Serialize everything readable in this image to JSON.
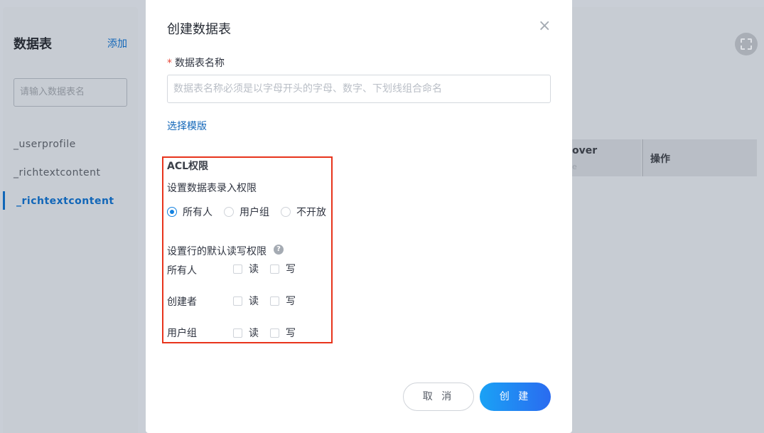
{
  "sidebar": {
    "title": "数据表",
    "add_label": "添加",
    "search_placeholder": "请输入数据表名",
    "items": [
      {
        "label": "_userprofile"
      },
      {
        "label": "_richtextcontent"
      },
      {
        "label": "_richtextcontent"
      }
    ]
  },
  "table": {
    "col_cover": "over",
    "col_cover_sub": "e",
    "col_op": "操作"
  },
  "modal": {
    "title": "创建数据表",
    "close_icon": "×",
    "name_label": "数据表名称",
    "required_mark": "*",
    "name_placeholder": "数据表名称必须是以字母开头的字母、数字、下划线组合命名",
    "template_link": "选择模版",
    "acl": {
      "title": "ACL权限",
      "entry_label": "设置数据表录入权限",
      "entry_options": [
        {
          "label": "所有人",
          "selected": true
        },
        {
          "label": "用户组",
          "selected": false
        },
        {
          "label": "不开放",
          "selected": false
        }
      ],
      "row_label": "设置行的默认读写权限",
      "help_icon": "?",
      "rows": [
        {
          "role": "所有人",
          "read": "读",
          "write": "写"
        },
        {
          "role": "创建者",
          "read": "读",
          "write": "写"
        },
        {
          "role": "用户组",
          "read": "读",
          "write": "写"
        }
      ]
    },
    "cancel_label": "取 消",
    "create_label": "创 建"
  },
  "colors": {
    "accent": "#1166b8",
    "primary_gradient_start": "#1aa2f5",
    "primary_gradient_end": "#2a6bf0",
    "highlight_border": "#e8341c"
  }
}
